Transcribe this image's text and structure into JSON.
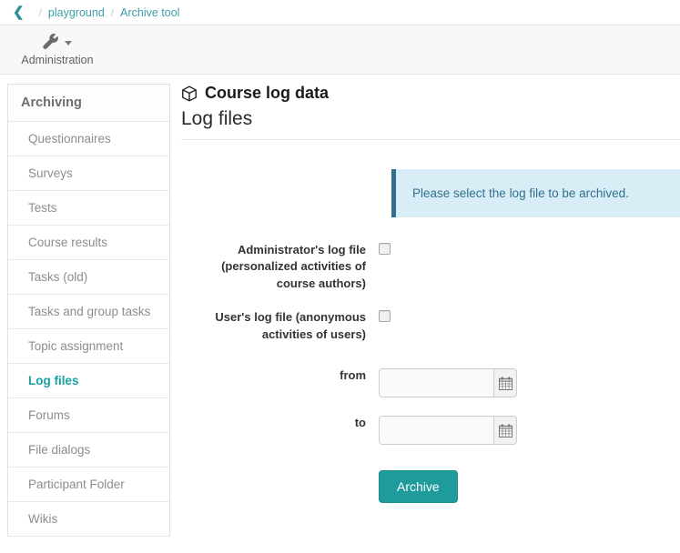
{
  "breadcrumb": {
    "back_icon": "chevron-left-icon",
    "separator": "/",
    "items": [
      {
        "label": "playground"
      },
      {
        "label": "Archive tool"
      }
    ]
  },
  "toolbar": {
    "admin": {
      "icon": "wrench-icon",
      "caret_icon": "caret-down-icon",
      "label": "Administration"
    }
  },
  "sidebar": {
    "header": "Archiving",
    "items": [
      {
        "label": "Questionnaires",
        "active": false
      },
      {
        "label": "Surveys",
        "active": false
      },
      {
        "label": "Tests",
        "active": false
      },
      {
        "label": "Course results",
        "active": false
      },
      {
        "label": "Tasks (old)",
        "active": false
      },
      {
        "label": "Tasks and group tasks",
        "active": false
      },
      {
        "label": "Topic assignment",
        "active": false
      },
      {
        "label": "Log files",
        "active": true
      },
      {
        "label": "Forums",
        "active": false
      },
      {
        "label": "File dialogs",
        "active": false
      },
      {
        "label": "Participant Folder",
        "active": false
      },
      {
        "label": "Wikis",
        "active": false
      }
    ]
  },
  "main": {
    "title_icon": "cube-icon",
    "title": "Course log data",
    "section_title": "Log files",
    "alert": {
      "text": "Please select the log file to be archived."
    },
    "form": {
      "admin_log": {
        "label": "Administrator's log file (personalized activities of course authors)",
        "checked": false
      },
      "user_log": {
        "label": "User's log file (anonymous activities of users)",
        "checked": false
      },
      "from": {
        "label": "from",
        "value": "",
        "placeholder": "",
        "calendar_icon": "calendar-icon"
      },
      "to": {
        "label": "to",
        "value": "",
        "placeholder": "",
        "calendar_icon": "calendar-icon"
      },
      "submit_label": "Archive"
    }
  },
  "colors": {
    "accent": "#1f9b9b",
    "link": "#3c9ea8",
    "alert_bg": "#d9edf7",
    "alert_border": "#31708f"
  }
}
